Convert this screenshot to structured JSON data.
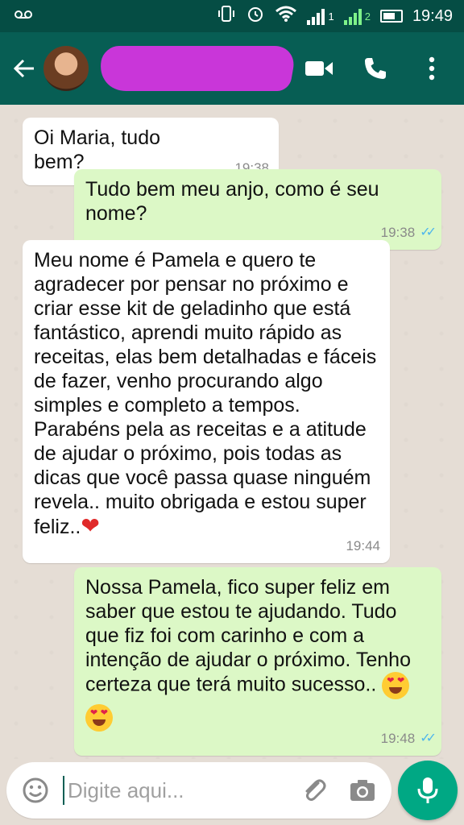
{
  "status_bar": {
    "carrier_icon": "voicemail-icon",
    "time": "19:49",
    "sim1_label": "1",
    "sim2_label": "2"
  },
  "header": {
    "back_icon": "arrow-left-icon",
    "video_icon": "video-call-icon",
    "call_icon": "phone-icon",
    "menu_icon": "more-vert-icon"
  },
  "messages": [
    {
      "direction": "in",
      "text": "Oi Maria, tudo bem?",
      "time": "19:38"
    },
    {
      "direction": "out",
      "text": "Tudo bem meu anjo, como é seu nome?",
      "time": "19:38",
      "status": "read"
    },
    {
      "direction": "in",
      "text": "Meu nome é Pamela e quero te agradecer por pensar no próximo e criar esse kit de geladinho que está fantástico, aprendi muito rápido as receitas, elas bem detalhadas e fáceis de fazer, venho procurando algo simples e completo a tempos. Parabéns pela as receitas e a atitude de ajudar o próximo, pois todas as dicas que você passa quase ninguém revela.. muito obrigada e estou super feliz..",
      "time": "19:44"
    },
    {
      "direction": "out",
      "text": "Nossa Pamela, fico super feliz em saber que estou te ajudando. Tudo que fiz foi com carinho e com a intenção de ajudar o próximo. Tenho certeza que terá muito sucesso..",
      "time": "19:48",
      "status": "read"
    }
  ],
  "composer": {
    "placeholder": "Digite aqui..."
  },
  "colors": {
    "header": "#075e54",
    "status_bar": "#054d44",
    "incoming_bubble": "#ffffff",
    "outgoing_bubble": "#dcf8c6",
    "read_ticks": "#4fb6ec",
    "mic_button": "#00a884"
  }
}
